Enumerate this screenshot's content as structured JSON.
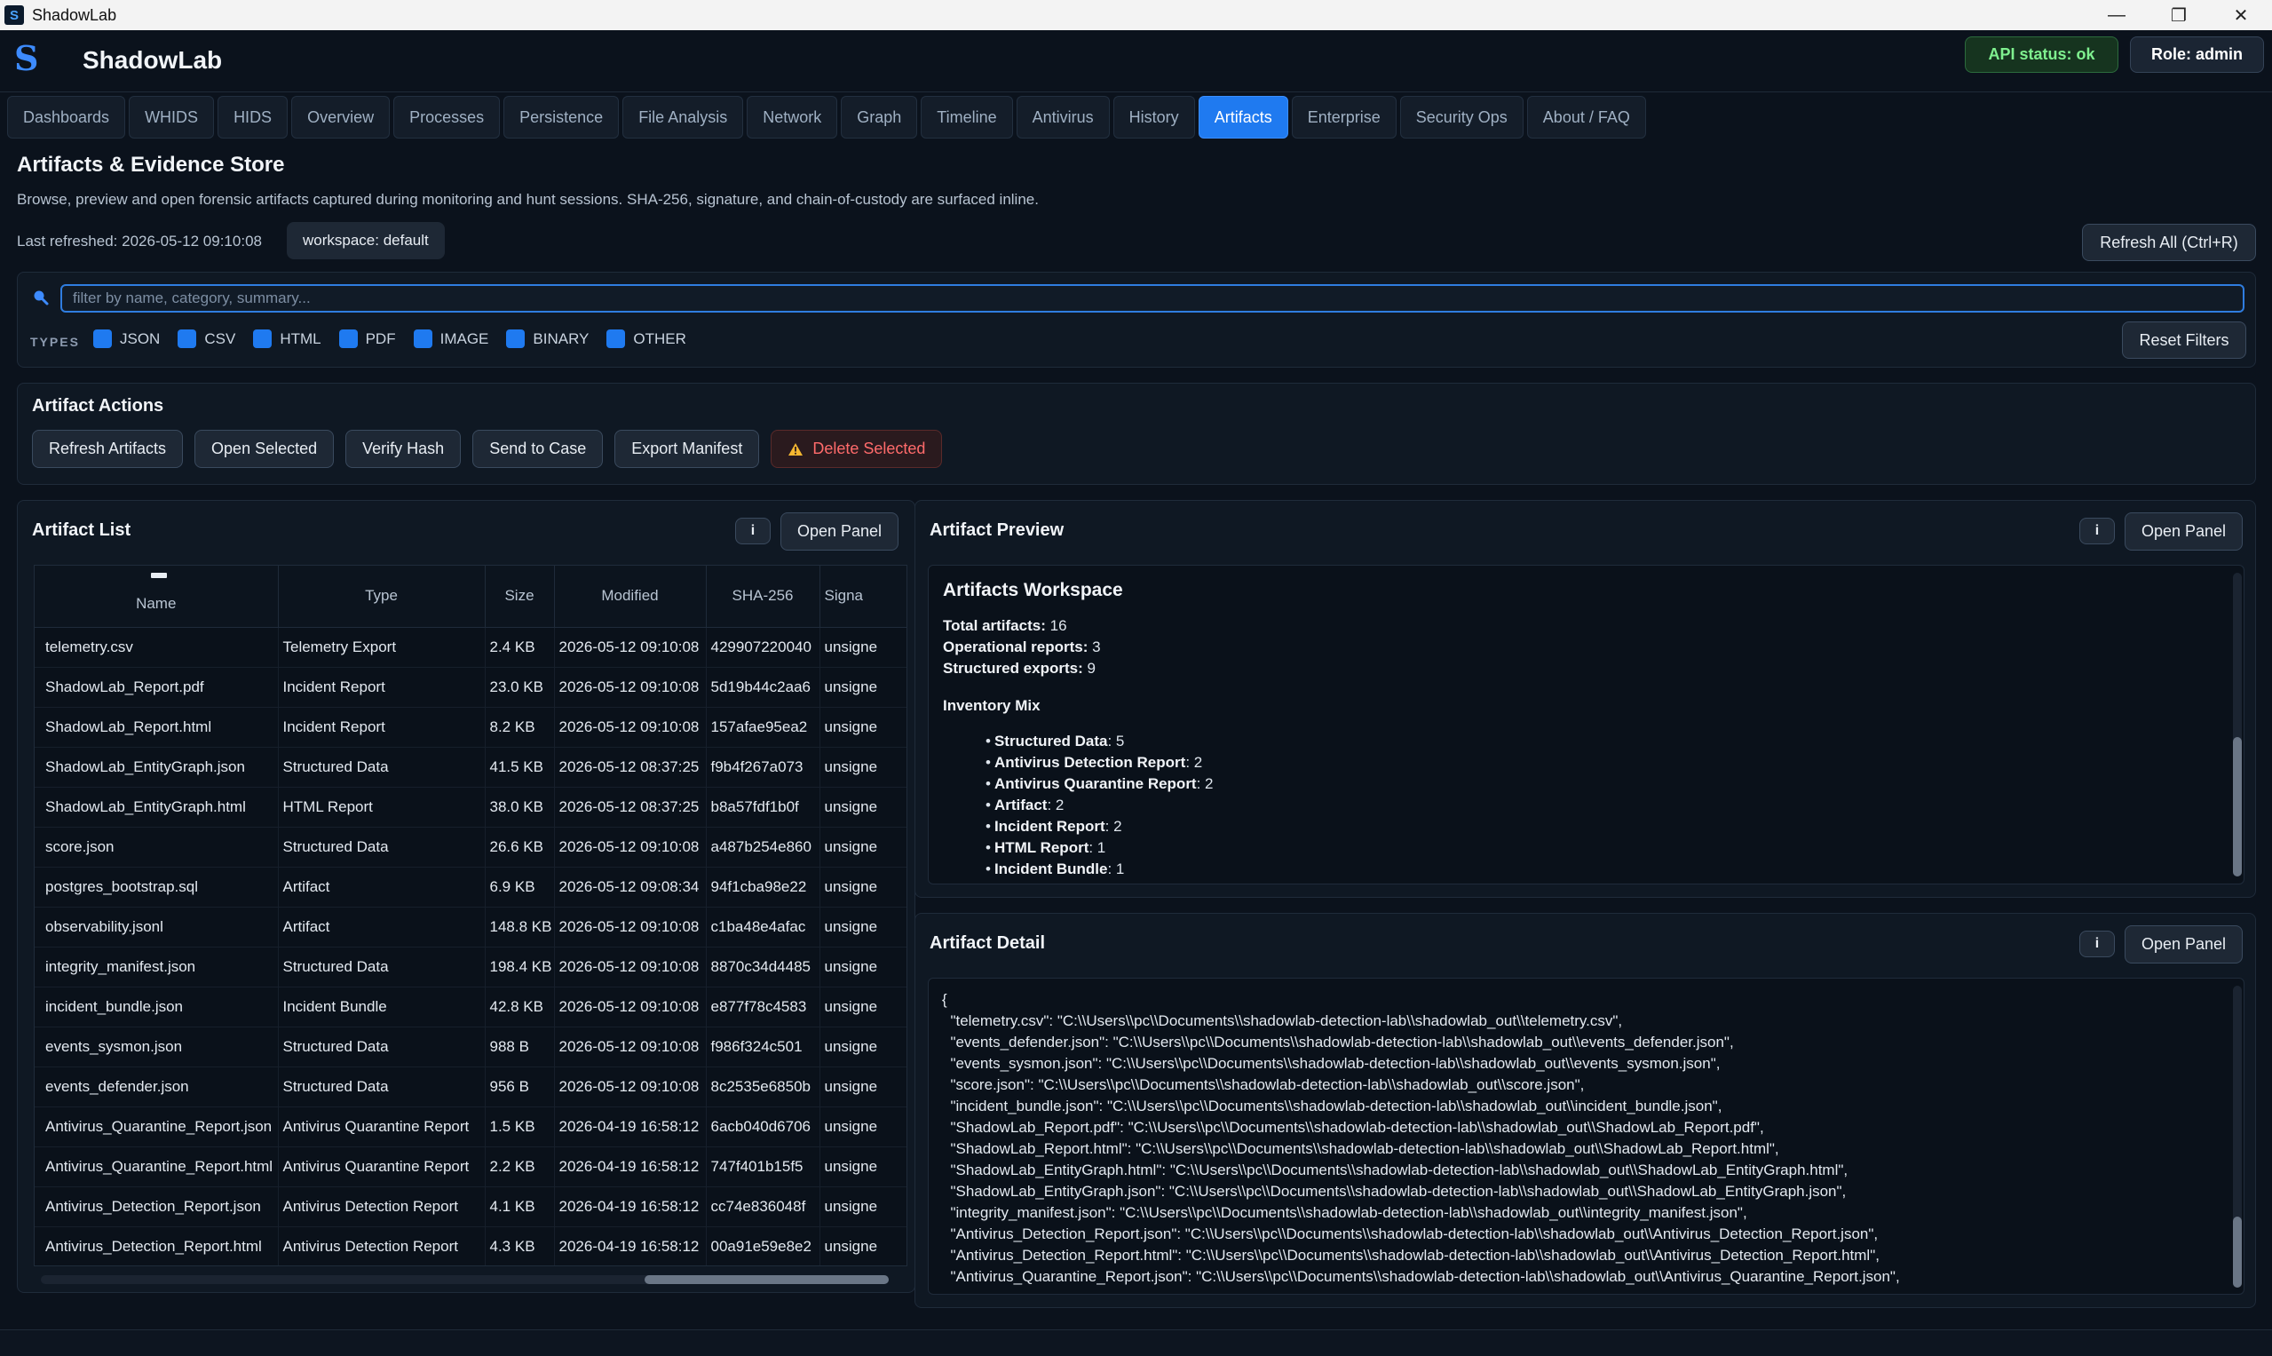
{
  "window": {
    "title": "ShadowLab",
    "controls": [
      "minimize",
      "restore",
      "close"
    ]
  },
  "header": {
    "logo": "S",
    "app_name": "ShadowLab",
    "api_status": "API status: ok",
    "role": "Role: admin"
  },
  "tabs": [
    "Dashboards",
    "WHIDS",
    "HIDS",
    "Overview",
    "Processes",
    "Persistence",
    "File Analysis",
    "Network",
    "Graph",
    "Timeline",
    "Antivirus",
    "History",
    "Artifacts",
    "Enterprise",
    "Security Ops",
    "About / FAQ"
  ],
  "active_tab": "Artifacts",
  "page": {
    "title": "Artifacts & Evidence Store",
    "description": "Browse, preview and open forensic artifacts captured during monitoring and hunt sessions. SHA-256, signature, and chain-of-custody are surfaced inline.",
    "last_refreshed": "Last refreshed: 2026-05-12 09:10:08",
    "workspace": "workspace: default",
    "refresh_all": "Refresh All (Ctrl+R)"
  },
  "filters": {
    "search_placeholder": "filter by name, category, summary...",
    "search_value": "",
    "types_label": "TYPES",
    "types": [
      "JSON",
      "CSV",
      "HTML",
      "PDF",
      "IMAGE",
      "BINARY",
      "OTHER"
    ],
    "reset": "Reset Filters"
  },
  "actions": {
    "title": "Artifact Actions",
    "buttons": [
      "Refresh Artifacts",
      "Open Selected",
      "Verify Hash",
      "Send to Case",
      "Export Manifest"
    ],
    "delete": "Delete Selected"
  },
  "artifact_list": {
    "title": "Artifact List",
    "info": "i",
    "open_panel": "Open Panel",
    "columns": [
      "Name",
      "Type",
      "Size",
      "Modified",
      "SHA-256",
      "Signa"
    ],
    "rows": [
      [
        "telemetry.csv",
        "Telemetry Export",
        "2.4 KB",
        "2026-05-12 09:10:08",
        "429907220040",
        "unsigne"
      ],
      [
        "ShadowLab_Report.pdf",
        "Incident Report",
        "23.0 KB",
        "2026-05-12 09:10:08",
        "5d19b44c2aa6",
        "unsigne"
      ],
      [
        "ShadowLab_Report.html",
        "Incident Report",
        "8.2 KB",
        "2026-05-12 09:10:08",
        "157afae95ea2",
        "unsigne"
      ],
      [
        "ShadowLab_EntityGraph.json",
        "Structured Data",
        "41.5 KB",
        "2026-05-12 08:37:25",
        "f9b4f267a073",
        "unsigne"
      ],
      [
        "ShadowLab_EntityGraph.html",
        "HTML Report",
        "38.0 KB",
        "2026-05-12 08:37:25",
        "b8a57fdf1b0f",
        "unsigne"
      ],
      [
        "score.json",
        "Structured Data",
        "26.6 KB",
        "2026-05-12 09:10:08",
        "a487b254e860",
        "unsigne"
      ],
      [
        "postgres_bootstrap.sql",
        "Artifact",
        "6.9 KB",
        "2026-05-12 09:08:34",
        "94f1cba98e22",
        "unsigne"
      ],
      [
        "observability.jsonl",
        "Artifact",
        "148.8 KB",
        "2026-05-12 09:10:08",
        "c1ba48e4afac",
        "unsigne"
      ],
      [
        "integrity_manifest.json",
        "Structured Data",
        "198.4 KB",
        "2026-05-12 09:10:08",
        "8870c34d4485",
        "unsigne"
      ],
      [
        "incident_bundle.json",
        "Incident Bundle",
        "42.8 KB",
        "2026-05-12 09:10:08",
        "e877f78c4583",
        "unsigne"
      ],
      [
        "events_sysmon.json",
        "Structured Data",
        "988 B",
        "2026-05-12 09:10:08",
        "f986f324c501",
        "unsigne"
      ],
      [
        "events_defender.json",
        "Structured Data",
        "956 B",
        "2026-05-12 09:10:08",
        "8c2535e6850b",
        "unsigne"
      ],
      [
        "Antivirus_Quarantine_Report.json",
        "Antivirus Quarantine Report",
        "1.5 KB",
        "2026-04-19 16:58:12",
        "6acb040d6706",
        "unsigne"
      ],
      [
        "Antivirus_Quarantine_Report.html",
        "Antivirus Quarantine Report",
        "2.2 KB",
        "2026-04-19 16:58:12",
        "747f401b15f5",
        "unsigne"
      ],
      [
        "Antivirus_Detection_Report.json",
        "Antivirus Detection Report",
        "4.1 KB",
        "2026-04-19 16:58:12",
        "cc74e836048f",
        "unsigne"
      ],
      [
        "Antivirus_Detection_Report.html",
        "Antivirus Detection Report",
        "4.3 KB",
        "2026-04-19 16:58:12",
        "00a91e59e8e2",
        "unsigne"
      ]
    ]
  },
  "preview": {
    "title": "Artifact Preview",
    "info": "i",
    "open_panel": "Open Panel",
    "heading": "Artifacts Workspace",
    "stats": [
      {
        "label": "Total artifacts:",
        "value": "16"
      },
      {
        "label": "Operational reports:",
        "value": "3"
      },
      {
        "label": "Structured exports:",
        "value": "9"
      }
    ],
    "mix_title": "Inventory Mix",
    "mix": [
      {
        "label": "Structured Data",
        "value": ": 5"
      },
      {
        "label": "Antivirus Detection Report",
        "value": ": 2"
      },
      {
        "label": "Antivirus Quarantine Report",
        "value": ": 2"
      },
      {
        "label": "Artifact",
        "value": ": 2"
      },
      {
        "label": "Incident Report",
        "value": ": 2"
      },
      {
        "label": "HTML Report",
        "value": ": 1"
      },
      {
        "label": "Incident Bundle",
        "value": ": 1"
      }
    ]
  },
  "detail": {
    "title": "Artifact Detail",
    "info": "i",
    "open_panel": "Open Panel",
    "lines": [
      "{",
      "  \"telemetry.csv\": \"C:\\\\Users\\\\pc\\\\Documents\\\\shadowlab-detection-lab\\\\shadowlab_out\\\\telemetry.csv\",",
      "  \"events_defender.json\": \"C:\\\\Users\\\\pc\\\\Documents\\\\shadowlab-detection-lab\\\\shadowlab_out\\\\events_defender.json\",",
      "  \"events_sysmon.json\": \"C:\\\\Users\\\\pc\\\\Documents\\\\shadowlab-detection-lab\\\\shadowlab_out\\\\events_sysmon.json\",",
      "  \"score.json\": \"C:\\\\Users\\\\pc\\\\Documents\\\\shadowlab-detection-lab\\\\shadowlab_out\\\\score.json\",",
      "  \"incident_bundle.json\": \"C:\\\\Users\\\\pc\\\\Documents\\\\shadowlab-detection-lab\\\\shadowlab_out\\\\incident_bundle.json\",",
      "  \"ShadowLab_Report.pdf\": \"C:\\\\Users\\\\pc\\\\Documents\\\\shadowlab-detection-lab\\\\shadowlab_out\\\\ShadowLab_Report.pdf\",",
      "  \"ShadowLab_Report.html\": \"C:\\\\Users\\\\pc\\\\Documents\\\\shadowlab-detection-lab\\\\shadowlab_out\\\\ShadowLab_Report.html\",",
      "  \"ShadowLab_EntityGraph.html\": \"C:\\\\Users\\\\pc\\\\Documents\\\\shadowlab-detection-lab\\\\shadowlab_out\\\\ShadowLab_EntityGraph.html\",",
      "  \"ShadowLab_EntityGraph.json\": \"C:\\\\Users\\\\pc\\\\Documents\\\\shadowlab-detection-lab\\\\shadowlab_out\\\\ShadowLab_EntityGraph.json\",",
      "  \"integrity_manifest.json\": \"C:\\\\Users\\\\pc\\\\Documents\\\\shadowlab-detection-lab\\\\shadowlab_out\\\\integrity_manifest.json\",",
      "  \"Antivirus_Detection_Report.json\": \"C:\\\\Users\\\\pc\\\\Documents\\\\shadowlab-detection-lab\\\\shadowlab_out\\\\Antivirus_Detection_Report.json\",",
      "  \"Antivirus_Detection_Report.html\": \"C:\\\\Users\\\\pc\\\\Documents\\\\shadowlab-detection-lab\\\\shadowlab_out\\\\Antivirus_Detection_Report.html\",",
      "  \"Antivirus_Quarantine_Report.json\": \"C:\\\\Users\\\\pc\\\\Documents\\\\shadowlab-detection-lab\\\\shadowlab_out\\\\Antivirus_Quarantine_Report.json\","
    ]
  },
  "colors": {
    "accent": "#1f7af0",
    "background": "#0b121c",
    "panel": "#0f1823",
    "status_ok": "#7ff08f",
    "danger": "#ff6b6b",
    "warning_icon": "#f5b731"
  }
}
